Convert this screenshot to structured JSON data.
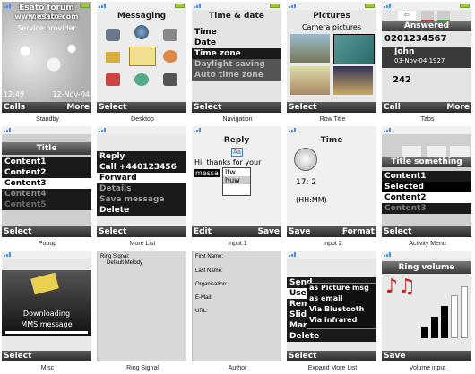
{
  "watermark": "Esato forum picture",
  "watermark_url": "www.esato.com",
  "captions": [
    "Standby",
    "Desktop",
    "Navigation",
    "Row Title",
    "Tabs",
    "Popup",
    "More List",
    "Input 1",
    "Input 2",
    "Activity Menu",
    "Misc",
    "Ring Signal",
    "Author",
    "Expand More List",
    "Volume input"
  ],
  "standby": {
    "provider": "Service provider",
    "time": "12:49",
    "date": "12-Nov-04",
    "left": "Calls",
    "right": "More"
  },
  "desktop": {
    "title": "Messaging",
    "left": "Select"
  },
  "navigation": {
    "title": "Time & date",
    "items": [
      "Time",
      "Date",
      "Time zone",
      "Daylight saving",
      "Auto time zone"
    ],
    "left": "Select"
  },
  "rowtitle": {
    "title": "Pictures",
    "subtitle": "Camera pictures",
    "left": "Select"
  },
  "tabs": {
    "title": "Answered",
    "number": "0201234567",
    "name": "John",
    "datetime": "03-Nov-04 1927",
    "count": "242",
    "left": "Call",
    "right": "More"
  },
  "popup": {
    "title": "Title",
    "items": [
      "Content1",
      "Content2",
      "Content3",
      "Content4",
      "Content5"
    ],
    "left": "Select"
  },
  "morelist": {
    "items": [
      "Reply",
      "Call +440123456",
      "Forward",
      "Details",
      "Save message",
      "Delete"
    ],
    "left": "Select"
  },
  "input1": {
    "title": "Reply",
    "mode": "Aa",
    "text1": "Hi, thanks for your",
    "text2": "messa",
    "sugg1": "ltw",
    "sugg2": "huw",
    "left": "Edit",
    "right": "Save"
  },
  "input2": {
    "title": "Time",
    "value": "17: 2",
    "format_hint": "(HH:MM)",
    "left": "Save",
    "right": "Format"
  },
  "activity": {
    "title": "Title something",
    "items": [
      "Content1",
      "Selected",
      "Content2",
      "Content3"
    ],
    "left": "Select"
  },
  "misc": {
    "line1": "Downloading",
    "line2": "MMS message",
    "left": "Select"
  },
  "ringsignal": {
    "label": "Ring Signal:",
    "value": "Default Melody"
  },
  "author": {
    "fields": [
      "First Name:",
      "Last Name:",
      "Organisation:",
      "E-Mail:",
      "URL:"
    ]
  },
  "expand": {
    "items": [
      "Send",
      "Use",
      "Remove",
      "Slide",
      "Manage",
      "Delete"
    ],
    "sub": [
      "as Picture msg",
      "as email",
      "Via Bluetooth",
      "Via infrared"
    ],
    "left": "Select"
  },
  "volume": {
    "title": "Ring volume",
    "level": 0.7,
    "left": "Save"
  },
  "colors": {
    "blue_tab": "#2a6ab8",
    "highlight": "#ffffff",
    "softbar": "#333333"
  }
}
